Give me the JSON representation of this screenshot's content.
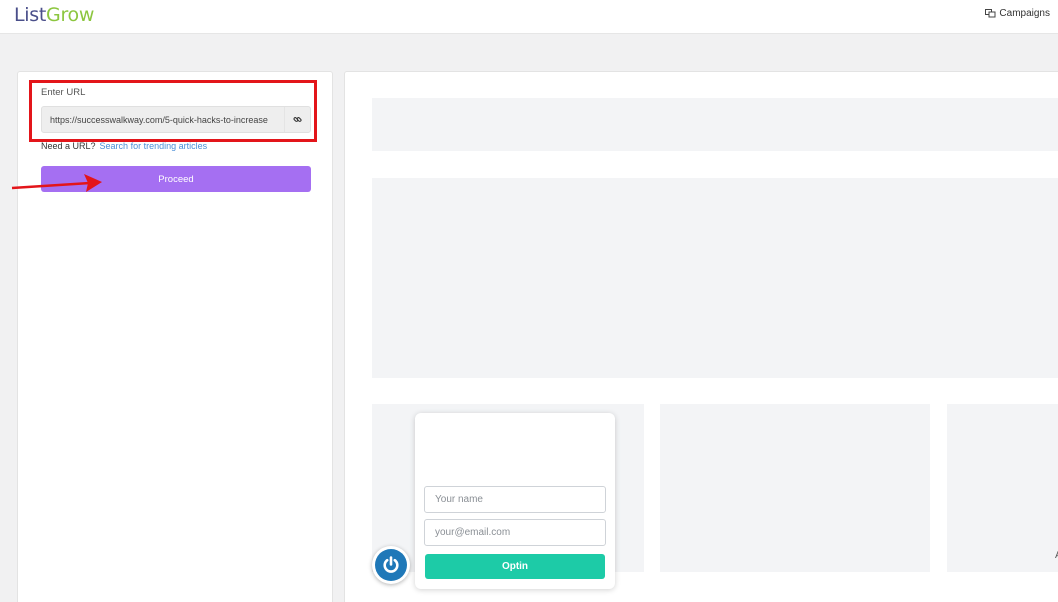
{
  "header": {
    "logo_part1": "List",
    "logo_part2": "Grow",
    "campaigns_label": "Campaigns",
    "campaigns_icon": "campaigns-icon"
  },
  "form": {
    "url_label": "Enter URL",
    "url_value": "https://successwalkway.com/5-quick-hacks-to-increase",
    "link_icon": "link-icon",
    "need_url_text": "Need a URL?",
    "search_link": "Search for trending articles",
    "proceed_label": "Proceed"
  },
  "optin": {
    "name_placeholder": "Your name",
    "email_placeholder": "your@email.com",
    "button_label": "Optin",
    "power_icon": "power-icon"
  },
  "preview": {
    "edge_char": "A"
  },
  "colors": {
    "logo_primary": "#4a4f8a",
    "logo_accent": "#8cc63f",
    "proceed_button": "#a56ff2",
    "optin_button": "#1dcba7",
    "highlight": "#e3151a",
    "link": "#4a8fd8",
    "power_button": "#1f78b8"
  }
}
